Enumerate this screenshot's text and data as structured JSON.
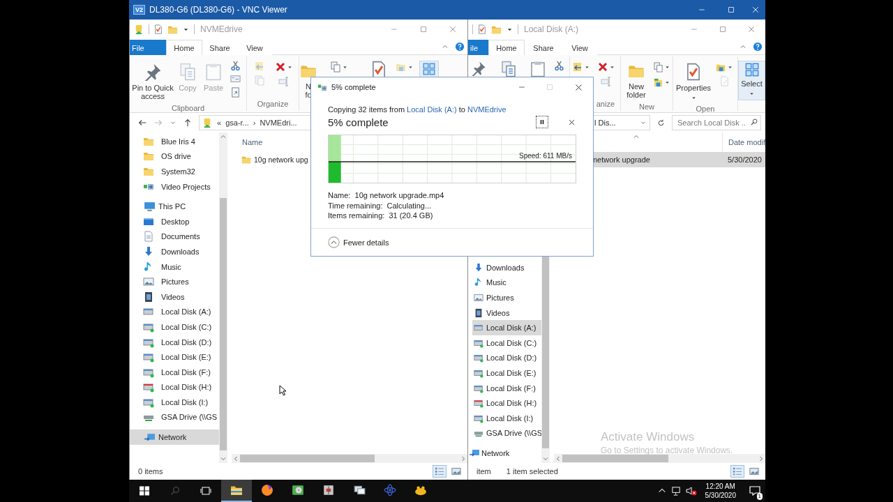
{
  "vnc": {
    "logo": "V2",
    "title": "DL380-G6 (DL380-G6) - VNC Viewer"
  },
  "left_window": {
    "title": "NVMEdrive",
    "tabs": [
      {
        "label": "File",
        "kind": "file",
        "selected": false
      },
      {
        "label": "Home",
        "kind": "tab",
        "selected": true
      },
      {
        "label": "Share",
        "kind": "tab",
        "selected": false
      },
      {
        "label": "View",
        "kind": "tab",
        "selected": false
      }
    ],
    "clipboard": {
      "label": "Clipboard",
      "buttons": [
        {
          "label": "Pin to Quick access",
          "kind": "pin",
          "disabled": false
        },
        {
          "label": "Copy",
          "kind": "copy",
          "disabled": true
        },
        {
          "label": "Paste",
          "kind": "paste",
          "disabled": true
        }
      ]
    },
    "organize": {
      "label": "Organize"
    },
    "new_folder": {
      "label": "N fo"
    },
    "path": {
      "overflow": "«",
      "crumbs": [
        {
          "label": "gsa-r...",
          "separator": "›"
        },
        {
          "label": "NVMEdri..."
        }
      ]
    },
    "nav": {
      "quick_access": [
        {
          "label": "Blue Iris 4",
          "kind": "folder",
          "selected": false
        },
        {
          "label": "OS drive",
          "kind": "folder",
          "selected": false
        },
        {
          "label": "System32",
          "kind": "folder",
          "selected": false
        },
        {
          "label": "Video Projects",
          "kind": "media",
          "selected": false
        }
      ],
      "tree": [
        {
          "label": "This PC",
          "kind": "pc",
          "selected": false,
          "children": [
            {
              "label": "Desktop",
              "kind": "desktop",
              "selected": false
            },
            {
              "label": "Documents",
              "kind": "documents",
              "selected": false
            },
            {
              "label": "Downloads",
              "kind": "downloads",
              "selected": false
            },
            {
              "label": "Music",
              "kind": "music",
              "selected": false
            },
            {
              "label": "Pictures",
              "kind": "pictures",
              "selected": false
            },
            {
              "label": "Videos",
              "kind": "videos",
              "selected": false
            },
            {
              "label": "Local Disk (A:)",
              "kind": "drive",
              "selected": false
            },
            {
              "label": "Local Disk (C:)",
              "kind": "drive-online",
              "selected": false
            },
            {
              "label": "Local Disk (D:)",
              "kind": "drive-online",
              "selected": false
            },
            {
              "label": "Local Disk (E:)",
              "kind": "drive-online",
              "selected": false
            },
            {
              "label": "Local Disk (F:)",
              "kind": "drive-online",
              "selected": false
            },
            {
              "label": "Local Disk (H:)",
              "kind": "drive-red",
              "selected": false
            },
            {
              "label": "Local Disk (I:)",
              "kind": "drive-online",
              "selected": false
            },
            {
              "label": "GSA Drive (\\\\GS",
              "kind": "network-drive",
              "selected": false
            }
          ]
        },
        {
          "label": "Network",
          "kind": "network",
          "selected": true
        }
      ]
    },
    "columns": [
      {
        "label": "Name"
      }
    ],
    "rows": [
      {
        "name": "10g network upg",
        "selected": false
      }
    ],
    "status": "0 items"
  },
  "right_window": {
    "title": "Local Disk (A:)",
    "tabs": [
      {
        "label": "ile",
        "kind": "file",
        "selected": false
      },
      {
        "label": "Home",
        "kind": "tab",
        "selected": true
      },
      {
        "label": "Share",
        "kind": "tab",
        "selected": false
      },
      {
        "label": "View",
        "kind": "tab",
        "selected": false
      }
    ],
    "organize": {
      "label": "anize"
    },
    "new": {
      "label": "New",
      "button": "New folder"
    },
    "open": {
      "label": "Open",
      "button": "Properties"
    },
    "select": {
      "button": "Select"
    },
    "address": "l Dis...",
    "search": {
      "placeholder": "Search Local Disk ..."
    },
    "nav": {
      "this_pc_children": [
        {
          "label": "Downloads",
          "kind": "downloads",
          "selected": false
        },
        {
          "label": "Music",
          "kind": "music",
          "selected": false
        },
        {
          "label": "Pictures",
          "kind": "pictures",
          "selected": false
        },
        {
          "label": "Videos",
          "kind": "videos",
          "selected": false
        },
        {
          "label": "Local Disk (A:)",
          "kind": "drive",
          "selected": true
        },
        {
          "label": "Local Disk (C:)",
          "kind": "drive-online",
          "selected": false
        },
        {
          "label": "Local Disk (D:)",
          "kind": "drive-online",
          "selected": false
        },
        {
          "label": "Local Disk (E:)",
          "kind": "drive-online",
          "selected": false
        },
        {
          "label": "Local Disk (F:)",
          "kind": "drive-online",
          "selected": false
        },
        {
          "label": "Local Disk (H:)",
          "kind": "drive-red",
          "selected": false
        },
        {
          "label": "Local Disk (I:)",
          "kind": "drive-online",
          "selected": false
        },
        {
          "label": "GSA Drive (\\\\GS",
          "kind": "network-drive",
          "selected": false
        }
      ],
      "roots": [
        {
          "label": "Network",
          "kind": "network",
          "selected": false
        }
      ]
    },
    "columns": [
      {
        "label": "Date modif"
      }
    ],
    "rows": [
      {
        "name": "network upgrade",
        "date": "5/30/2020",
        "selected": true
      }
    ],
    "status": [
      "item",
      "1 item selected"
    ]
  },
  "copy_dialog": {
    "title": "5% complete",
    "message": {
      "prefix": "Copying 32 items from ",
      "source": "Local Disk (A:)",
      "middle": " to ",
      "destination": "NVMEdrive"
    },
    "heading": "5% complete",
    "level": 0.05,
    "speed": "Speed: 611 MB/s",
    "details": [
      "Name:  10g network upgrade.mp4",
      "Time remaining:  Calculating...",
      "Items remaining:  31 (20.4 GB)"
    ],
    "toggle": "Fewer details"
  },
  "activation": {
    "title": "Activate Windows",
    "subtitle": "Go to Settings to activate Windows."
  },
  "taskbar": {
    "apps": [
      {
        "kind": "explorer",
        "selected": true
      },
      {
        "kind": "browser",
        "selected": false
      },
      {
        "kind": "drive-app",
        "selected": false
      },
      {
        "kind": "toolbox",
        "selected": false
      },
      {
        "kind": "monitor-app",
        "selected": false
      },
      {
        "kind": "atom",
        "selected": false
      },
      {
        "kind": "creature",
        "selected": false
      }
    ],
    "time": "12:20 AM",
    "date": "5/30/2020",
    "notifications": "1"
  }
}
